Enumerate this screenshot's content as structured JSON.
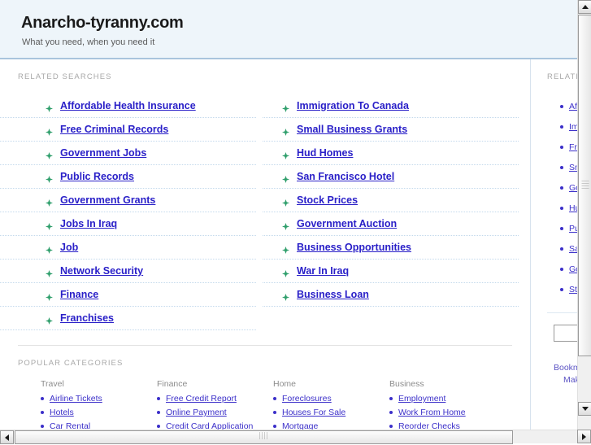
{
  "header": {
    "title": "Anarcho-tyranny.com",
    "tagline": "What you need, when you need it"
  },
  "main": {
    "related_label": "RELATED SEARCHES",
    "popular_label": "POPULAR CATEGORIES",
    "related_columns": [
      [
        "Affordable Health Insurance",
        "Free Criminal Records",
        "Government Jobs",
        "Public Records",
        "Government Grants",
        "Jobs In Iraq",
        "Job",
        "Network Security",
        "Finance",
        "Franchises"
      ],
      [
        "Immigration To Canada",
        "Small Business Grants",
        "Hud Homes",
        "San Francisco Hotel",
        "Stock Prices",
        "Government Auction",
        "Business Opportunities",
        "War In Iraq",
        "Business Loan"
      ]
    ],
    "popular_categories": [
      {
        "heading": "Travel",
        "links": [
          "Airline Tickets",
          "Hotels",
          "Car Rental"
        ]
      },
      {
        "heading": "Finance",
        "links": [
          "Free Credit Report",
          "Online Payment",
          "Credit Card Application"
        ]
      },
      {
        "heading": "Home",
        "links": [
          "Foreclosures",
          "Houses For Sale",
          "Mortgage"
        ]
      },
      {
        "heading": "Business",
        "links": [
          "Employment",
          "Work From Home",
          "Reorder Checks"
        ]
      }
    ]
  },
  "sidebar": {
    "label": "RELATED SEARCHES",
    "links": [
      "Affordable Health Insurance",
      "Immigration To Canada",
      "Free Criminal Records",
      "Small Business Grants",
      "Government Jobs",
      "Hud Homes",
      "Public Records",
      "San Francisco Hotel",
      "Government Grants",
      "Stock Prices"
    ],
    "search_value": "",
    "search_placeholder": "",
    "actions": [
      "Bookmark this page",
      "Make this my homepage"
    ]
  },
  "colors": {
    "header_bg": "#eef5fa",
    "header_rule": "#a9c4dd",
    "link_blue": "#2a20c8",
    "small_link_blue": "#3b2fc9",
    "bullet_green": "#2e9e6b",
    "label_gray": "#a8a8a8",
    "dotted_rule": "#c3d9ec"
  },
  "scrollbars": {
    "vertical": {
      "up_icon": "triangle-up-icon",
      "down_icon": "triangle-down-icon"
    },
    "horizontal": {
      "left_icon": "triangle-left-icon",
      "right_icon": "triangle-right-icon"
    }
  }
}
